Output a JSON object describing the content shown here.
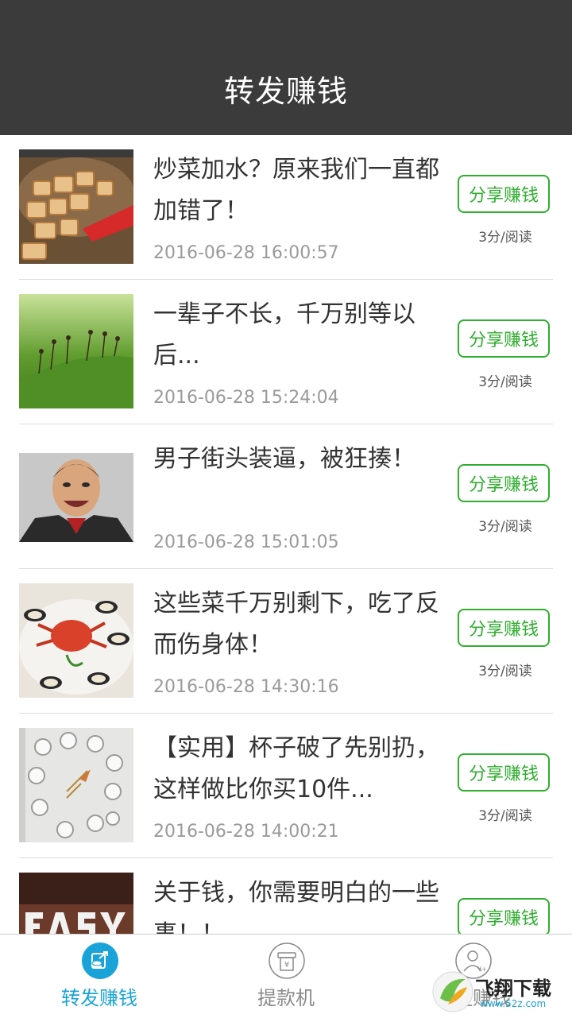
{
  "header": {
    "title": "转发赚钱"
  },
  "articles": [
    {
      "title": "炒菜加水？原来我们一直都加错了！",
      "time": "2016-06-28 16:00:57",
      "share_label": "分享赚钱",
      "rate": "3分/阅读",
      "thumb": "fried-pork-thumbnail"
    },
    {
      "title": "一辈子不长，千万别等以后...",
      "time": "2016-06-28 15:24:04",
      "share_label": "分享赚钱",
      "rate": "3分/阅读",
      "thumb": "green-grass-thumbnail"
    },
    {
      "title": "男子街头装逼，被狂揍！",
      "time": "2016-06-28 15:01:05",
      "share_label": "分享赚钱",
      "rate": "3分/阅读",
      "thumb": "laughing-man-thumbnail"
    },
    {
      "title": "这些菜千万别剩下，吃了反而伤身体！",
      "time": "2016-06-28 14:30:16",
      "share_label": "分享赚钱",
      "rate": "3分/阅读",
      "thumb": "seafood-plate-thumbnail"
    },
    {
      "title": "【实用】杯子破了先别扔，这样做比你买10件...",
      "time": "2016-06-28 14:00:21",
      "share_label": "分享赚钱",
      "rate": "3分/阅读",
      "thumb": "cups-wall-thumbnail"
    },
    {
      "title": "关于钱，你需要明白的一些事！！",
      "time": "",
      "share_label": "分享赚钱",
      "rate": "",
      "thumb": "easy-sign-thumbnail"
    }
  ],
  "tabs": [
    {
      "label": "转发赚钱",
      "active": true,
      "icon": "share-earn-icon"
    },
    {
      "label": "提款机",
      "active": false,
      "icon": "atm-icon"
    },
    {
      "label": "收徒赚钱",
      "active": false,
      "icon": "user-earn-icon"
    }
  ],
  "watermark": {
    "text": "飞翔下载",
    "sub": "www.52z.com"
  },
  "colors": {
    "header_bg": "#3b3b3b",
    "accent_green": "#2fae2f",
    "accent_blue": "#1aa3d9"
  }
}
